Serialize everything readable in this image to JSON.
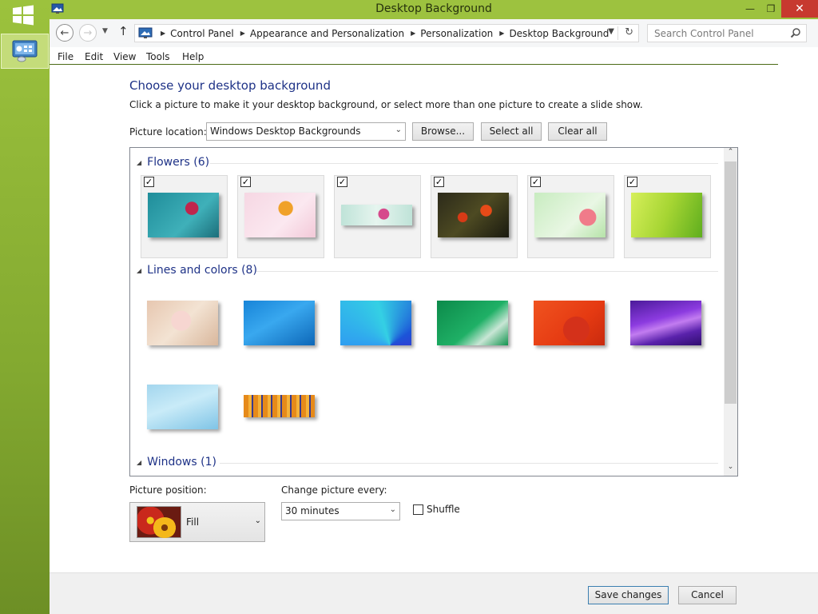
{
  "window": {
    "title": "Desktop Background"
  },
  "nav": {
    "breadcrumbs": [
      "Control Panel",
      "Appearance and Personalization",
      "Personalization",
      "Desktop Background"
    ],
    "search_placeholder": "Search Control Panel"
  },
  "menu": [
    "File",
    "Edit",
    "View",
    "Tools",
    "Help"
  ],
  "main": {
    "heading": "Choose your desktop background",
    "subtext": "Click a picture to make it your desktop background, or select more than one picture to create a slide show.",
    "location_label": "Picture location:",
    "location_value": "Windows Desktop Backgrounds",
    "browse_label": "Browse...",
    "select_all_label": "Select all",
    "clear_all_label": "Clear all"
  },
  "groups": [
    {
      "title": "Flowers (6)",
      "items": [
        {
          "checked": true,
          "desc": "red flower on teal"
        },
        {
          "checked": true,
          "desc": "orange flower on pink"
        },
        {
          "checked": true,
          "desc": "pink flower on mint"
        },
        {
          "checked": true,
          "desc": "red tulips on dark"
        },
        {
          "checked": true,
          "desc": "pink flower on green"
        },
        {
          "checked": true,
          "desc": "green leaves"
        }
      ]
    },
    {
      "title": "Lines and colors (8)",
      "items": [
        {
          "checked": false,
          "desc": "cartoon pink"
        },
        {
          "checked": false,
          "desc": "blue lines"
        },
        {
          "checked": false,
          "desc": "blue fan"
        },
        {
          "checked": false,
          "desc": "green"
        },
        {
          "checked": false,
          "desc": "orange red"
        },
        {
          "checked": false,
          "desc": "purple waves"
        },
        {
          "checked": false,
          "desc": "light blue"
        },
        {
          "checked": false,
          "desc": "orange stripes"
        }
      ]
    },
    {
      "title": "Windows (1)",
      "items": []
    }
  ],
  "position": {
    "label": "Picture position:",
    "value": "Fill"
  },
  "interval": {
    "label": "Change picture every:",
    "value": "30 minutes"
  },
  "shuffle": {
    "label": "Shuffle",
    "checked": false
  },
  "footer": {
    "save_label": "Save changes",
    "cancel_label": "Cancel"
  },
  "colors": {
    "accent": "#1e3287",
    "frame": "#9dc23f",
    "close": "#c7392f"
  }
}
